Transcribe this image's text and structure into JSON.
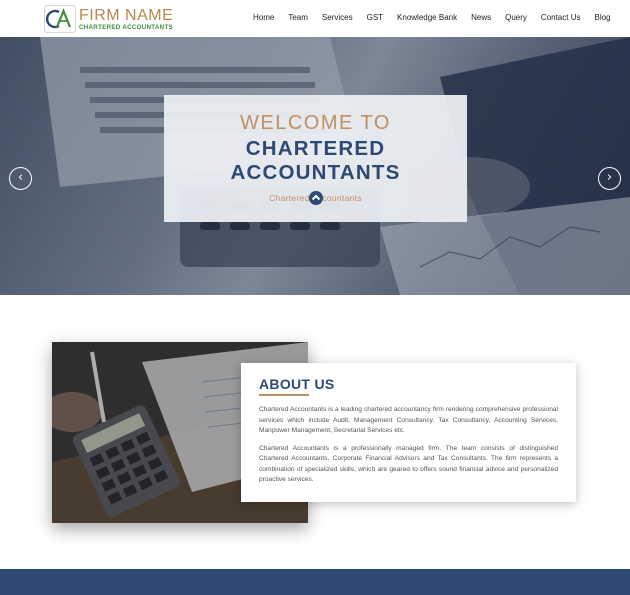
{
  "header": {
    "brand_name": "FIRM NAME",
    "brand_sub": "CHARTERED ACCOUNTANTS",
    "logo_letters": "CA",
    "nav": [
      "Home",
      "Team",
      "Services",
      "GST",
      "Knowledge Bank",
      "News",
      "Query",
      "Contact Us",
      "Blog"
    ]
  },
  "hero": {
    "title_line1": "WELCOME TO",
    "title_line2": "CHARTERED ACCOUNTANTS",
    "subtitle": "Chartered Accountants",
    "prev_icon": "chevron-left-icon",
    "next_icon": "chevron-right-icon"
  },
  "about": {
    "title": "ABOUT US",
    "paragraph1": "Chartered Accountants is a leading chartered accountancy firm rendering comprehensive professional services which include Audit, Management Consultancy, Tax Consultancy, Accounting Services, Manpower Management, Secretarial Services etc.",
    "paragraph2": "Chartered Accountants is a professionally managed firm. The team consists of distinguished Chartered Accountants, Corporate Financial Advisors and Tax Consultants. The firm represents a combination of specialized skills, which are geared to offers sound financial advice and personalized proactive services."
  },
  "colors": {
    "brand_gold": "#c09060",
    "brand_navy": "#2c4a73",
    "brand_green": "#3b8e3a"
  }
}
